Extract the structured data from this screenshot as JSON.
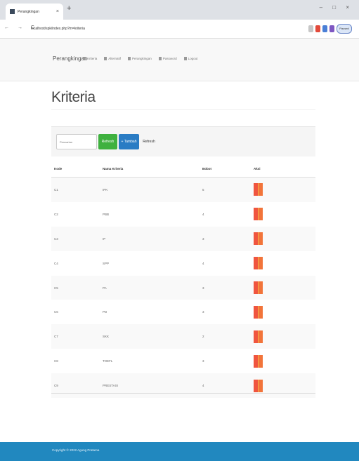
{
  "browser": {
    "tab_title": "Perangkingan",
    "tab_close": "×",
    "new_tab": "+",
    "window_controls": "– □ ×",
    "nav_buttons": "← → C",
    "url": "localhost/spk/index.php?m=kriteria",
    "profile_label": "Paused"
  },
  "navbar": {
    "brand": "Perangkingan",
    "items": [
      {
        "label": "Kriteria"
      },
      {
        "label": "Alternatif"
      },
      {
        "label": "Perangkingan"
      },
      {
        "label": "Password"
      },
      {
        "label": "Logout"
      }
    ]
  },
  "page": {
    "title": "Kriteria"
  },
  "toolbar": {
    "search_placeholder": "Pencarian",
    "search_button": "Refresh",
    "add_button": "+ Tambah",
    "reset_button": "Refresh"
  },
  "table": {
    "headers": [
      "Kode",
      "Nama Kriteria",
      "Bobot",
      "Aksi"
    ],
    "rows": [
      {
        "kode": "C1",
        "nama": "IPK",
        "bobot": "5"
      },
      {
        "kode": "C2",
        "nama": "PBB",
        "bobot": "4"
      },
      {
        "kode": "C3",
        "nama": "IP",
        "bobot": "3"
      },
      {
        "kode": "C4",
        "nama": "SPP",
        "bobot": "4"
      },
      {
        "kode": "C5",
        "nama": "PA",
        "bobot": "3"
      },
      {
        "kode": "C6",
        "nama": "PD",
        "bobot": "3"
      },
      {
        "kode": "C7",
        "nama": "SKK",
        "bobot": "2"
      },
      {
        "kode": "C8",
        "nama": "TOEFL",
        "bobot": "3"
      },
      {
        "kode": "C9",
        "nama": "PRESTASI",
        "bobot": "4"
      }
    ]
  },
  "footer": {
    "text": "Copyright © 2022 Agung Pratama"
  },
  "colors": {
    "search_button": "#3fb13f",
    "add_button": "#2a7cc4",
    "edit_button": "#f0553f",
    "delete_button": "#f2743a",
    "footer": "#2188bf"
  }
}
